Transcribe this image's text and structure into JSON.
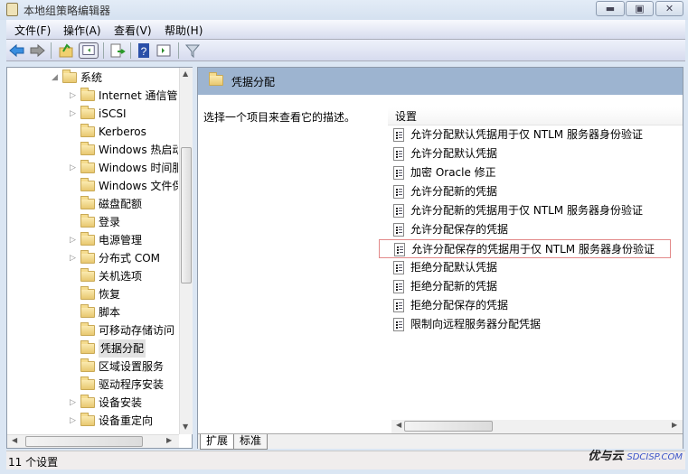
{
  "window": {
    "title": "本地组策略编辑器",
    "controls": [
      "minimize",
      "maximize",
      "close"
    ]
  },
  "menu": [
    "文件(F)",
    "操作(A)",
    "查看(V)",
    "帮助(H)"
  ],
  "toolbar": [
    "back-icon",
    "forward-icon",
    "up-folder-icon",
    "show-hide-tree-icon",
    "export-list-icon",
    "help-icon",
    "show-action-pane-icon",
    "filter-icon"
  ],
  "tree": {
    "root": "系统",
    "items": [
      {
        "label": "Internet 通信管理",
        "expandable": true
      },
      {
        "label": "iSCSI",
        "expandable": true
      },
      {
        "label": "Kerberos",
        "expandable": false
      },
      {
        "label": "Windows 热启动",
        "expandable": false
      },
      {
        "label": "Windows 时间服务",
        "expandable": true
      },
      {
        "label": "Windows 文件保护",
        "expandable": false
      },
      {
        "label": "磁盘配额",
        "expandable": false
      },
      {
        "label": "登录",
        "expandable": false
      },
      {
        "label": "电源管理",
        "expandable": true
      },
      {
        "label": "分布式 COM",
        "expandable": true
      },
      {
        "label": "关机选项",
        "expandable": false
      },
      {
        "label": "恢复",
        "expandable": false
      },
      {
        "label": "脚本",
        "expandable": false
      },
      {
        "label": "可移动存储访问",
        "expandable": false
      },
      {
        "label": "凭据分配",
        "expandable": false,
        "selected": true
      },
      {
        "label": "区域设置服务",
        "expandable": false
      },
      {
        "label": "驱动程序安装",
        "expandable": false
      },
      {
        "label": "设备安装",
        "expandable": true
      },
      {
        "label": "设备重定向",
        "expandable": true
      }
    ]
  },
  "content": {
    "header": "凭据分配",
    "description": "选择一个项目来查看它的描述。",
    "column": "设置",
    "settings": [
      "允许分配默认凭据用于仅 NTLM 服务器身份验证",
      "允许分配默认凭据",
      "加密 Oracle 修正",
      "允许分配新的凭据",
      "允许分配新的凭据用于仅 NTLM 服务器身份验证",
      "允许分配保存的凭据",
      "允许分配保存的凭据用于仅 NTLM 服务器身份验证",
      "拒绝分配默认凭据",
      "拒绝分配新的凭据",
      "拒绝分配保存的凭据",
      "限制向远程服务器分配凭据"
    ],
    "highlighted_index": 6,
    "tabs": [
      "扩展",
      "标准"
    ],
    "active_tab": "扩展"
  },
  "status": "11 个设置",
  "watermark": {
    "text": "优与云",
    "site": "SDCISP.COM"
  },
  "colors": {
    "header_band": "#9db4d0",
    "highlight_border": "#e38a8a",
    "window_bg": "#dbe6f3"
  }
}
